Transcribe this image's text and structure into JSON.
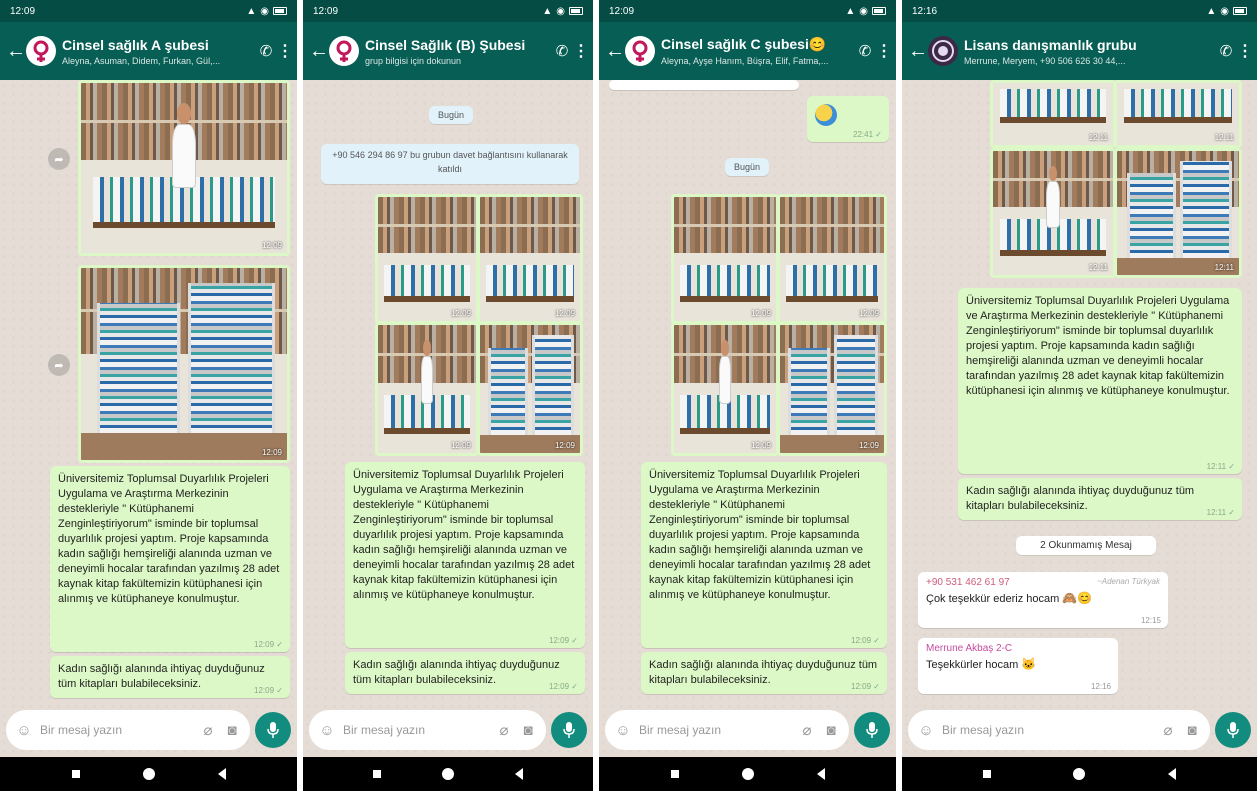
{
  "phones": [
    {
      "status_time": "12:09",
      "group_name": "Cinsel sağlık A şubesi",
      "group_sub": "Aleyna, Asuman, Didem, Furkan, Gül,...",
      "photo_times": [
        "12:09",
        "12:09"
      ],
      "message_1": "Üniversitemiz Toplumsal Duyarlılık Projeleri Uygulama ve Araştırma Merkezinin destekleriyle \" Kütüphanemi Zenginleştiriyorum\" isminde bir toplumsal duyarlılık projesi yaptım. Proje kapsamında kadın sağlığı hemşireliği alanında uzman ve deneyimli hocalar tarafından yazılmış 28 adet kaynak kitap fakültemizin kütüphanesi için alınmış ve kütüphaneye konulmuştur.",
      "message_1_time": "12:09",
      "message_2": "Kadın sağlığı alanında ihtiyaç duyduğunuz tüm kitapları bulabileceksiniz.",
      "message_2_time": "12:09",
      "placeholder": "Bir mesaj yazın"
    },
    {
      "status_time": "12:09",
      "group_name": "Cinsel Sağlık (B) Şubesi",
      "group_sub": "grup bilgisi için dokunun",
      "date_chip": "Bugün",
      "system_msg": "+90 546 294 86 97 bu grubun davet bağlantısını kullanarak katıldı",
      "photo_times": [
        "12:09",
        "12:09",
        "12:09",
        "12:09"
      ],
      "message_1": "Üniversitemiz Toplumsal Duyarlılık Projeleri Uygulama ve Araştırma Merkezinin destekleriyle \" Kütüphanemi Zenginleştiriyorum\" isminde bir toplumsal duyarlılık projesi yaptım. Proje kapsamında kadın sağlığı hemşireliği alanında uzman ve deneyimli hocalar tarafından yazılmış 28 adet kaynak kitap fakültemizin kütüphanesi için alınmış ve kütüphaneye konulmuştur.",
      "message_1_time": "12:09",
      "message_2": "Kadın sağlığı alanında ihtiyaç duyduğunuz tüm kitapları bulabileceksiniz.",
      "message_2_time": "12:09",
      "placeholder": "Bir mesaj yazın"
    },
    {
      "status_time": "12:09",
      "group_name": "Cinsel sağlık C şubesi😊",
      "group_sub": "Aleyna, Ayşe Hanım, Büşra, Elif, Fatma,...",
      "sticker_time": "22:41",
      "date_chip": "Bugün",
      "photo_times": [
        "12:09",
        "12:09",
        "12:09",
        "12:09"
      ],
      "message_1": "Üniversitemiz Toplumsal Duyarlılık Projeleri Uygulama ve Araştırma Merkezinin destekleriyle \" Kütüphanemi Zenginleştiriyorum\" isminde bir toplumsal duyarlılık projesi yaptım. Proje kapsamında kadın sağlığı hemşireliği alanında uzman ve deneyimli hocalar tarafından yazılmış 28 adet kaynak kitap fakültemizin kütüphanesi için alınmış ve kütüphaneye konulmuştur.",
      "message_1_time": "12:09",
      "message_2": "Kadın sağlığı alanında ihtiyaç duyduğunuz tüm kitapları bulabileceksiniz.",
      "message_2_time": "12:09",
      "placeholder": "Bir mesaj yazın"
    },
    {
      "status_time": "12:16",
      "group_name": "Lisans danışmanlık grubu",
      "group_sub": "Merrune, Meryem, +90 506 626 30 44,...",
      "photo_times": [
        "12:11",
        "12:11",
        "12:11",
        "12:11"
      ],
      "message_1": "Üniversitemiz Toplumsal Duyarlılık Projeleri Uygulama ve Araştırma Merkezinin destekleriyle \" Kütüphanemi Zenginleştiriyorum\" isminde bir toplumsal duyarlılık projesi yaptım. Proje kapsamında kadın sağlığı hemşireliği alanında uzman ve deneyimli hocalar tarafından yazılmış 28 adet kaynak kitap fakültemizin kütüphanesi için alınmış ve kütüphaneye konulmuştur.",
      "message_1_time": "12:11",
      "message_2": "Kadın sağlığı alanında ihtiyaç duyduğunuz tüm kitapları bulabileceksiniz.",
      "message_2_time": "12:11",
      "unread_chip": "2 Okunmamış Mesaj",
      "reply_1_sender": "+90 531 462 61 97",
      "reply_1_alt": "~Adenan Türkyak",
      "reply_1_text": "Çok teşekkür ederiz hocam",
      "reply_1_emoji": "🙈😊",
      "reply_1_time": "12:15",
      "reply_2_sender": "Merrune Akbaş 2-C",
      "reply_2_text": "Teşekkürler hocam",
      "reply_2_emoji": "🐱",
      "reply_2_time": "12:16",
      "placeholder": "Bir mesaj yazın"
    }
  ],
  "icons": {
    "back": "arrow-left-icon",
    "call": "add-call-icon",
    "menu": "more-vert-icon",
    "emoji": "emoji-icon",
    "attach": "paperclip-icon",
    "camera": "camera-icon",
    "mic": "mic-icon",
    "forward": "forward-icon"
  },
  "colors": {
    "header": "#075e54",
    "status_bar": "#054d44",
    "outgoing_bubble": "#dcf8c6",
    "incoming_bubble": "#ffffff",
    "chat_bg": "#e5ddd5",
    "mic_button": "#128c7e",
    "date_chip": "#e1f2fb"
  }
}
